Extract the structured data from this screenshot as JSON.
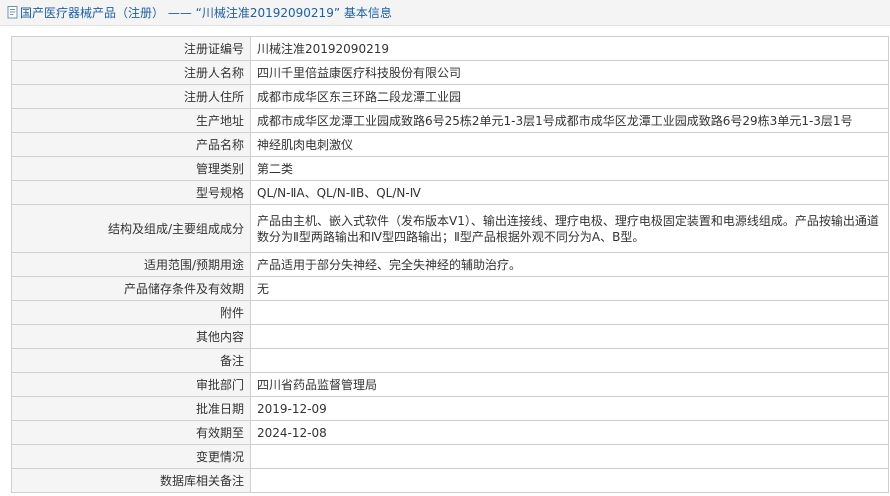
{
  "header": {
    "title": "国产医疗器械产品（注册） —— “川械注准20192090219” 基本信息"
  },
  "rows": [
    {
      "label": "注册证编号",
      "value": "川械注准20192090219"
    },
    {
      "label": "注册人名称",
      "value": "四川千里倍益康医疗科技股份有限公司"
    },
    {
      "label": "注册人住所",
      "value": "成都市成华区东三环路二段龙潭工业园"
    },
    {
      "label": "生产地址",
      "value": "成都市成华区龙潭工业园成致路6号25栋2单元1-3层1号成都市成华区龙潭工业园成致路6号29栋3单元1-3层1号"
    },
    {
      "label": "产品名称",
      "value": "神经肌肉电刺激仪"
    },
    {
      "label": "管理类别",
      "value": "第二类"
    },
    {
      "label": "型号规格",
      "value": "QL/N-ⅡA、QL/N-ⅡB、QL/N-Ⅳ"
    },
    {
      "label": "结构及组成/主要组成成分",
      "value": "产品由主机、嵌入式软件（发布版本V1）、输出连接线、理疗电极、理疗电极固定装置和电源线组成。产品按输出通道数分为Ⅱ型两路输出和Ⅳ型四路输出；Ⅱ型产品根据外观不同分为A、B型。"
    },
    {
      "label": "适用范围/预期用途",
      "value": "产品适用于部分失神经、完全失神经的辅助治疗。"
    },
    {
      "label": "产品储存条件及有效期",
      "value": "无"
    },
    {
      "label": "附件",
      "value": ""
    },
    {
      "label": "其他内容",
      "value": ""
    },
    {
      "label": "备注",
      "value": ""
    },
    {
      "label": "审批部门",
      "value": "四川省药品监督管理局"
    },
    {
      "label": "批准日期",
      "value": "2019-12-09"
    },
    {
      "label": "有效期至",
      "value": "2024-12-08"
    },
    {
      "label": "变更情况",
      "value": ""
    },
    {
      "label": "数据库相关备注",
      "value": ""
    }
  ]
}
